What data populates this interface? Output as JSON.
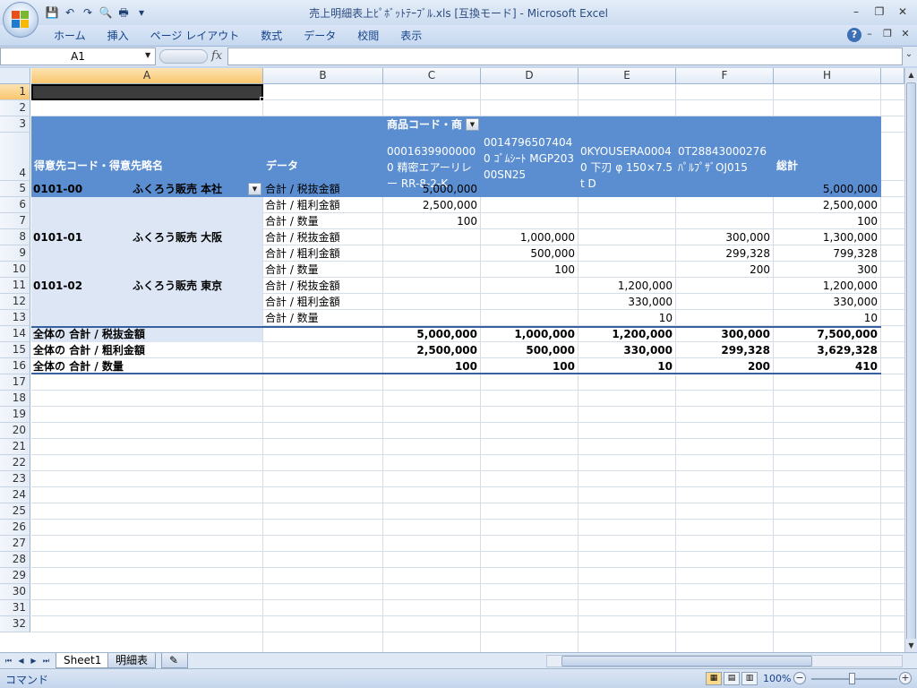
{
  "window": {
    "title": "売上明細表上ﾋﾟﾎﾞｯﾄﾃｰﾌﾞﾙ.xls  [互換モード] - Microsoft Excel",
    "minimize": "–",
    "restore": "❐",
    "close": "✕"
  },
  "qat": {
    "save": "💾",
    "undo": "↶",
    "redo": "↷",
    "preview": "🔍",
    "print": "🖶",
    "more": "▾"
  },
  "ribbon": {
    "tabs": [
      "ホーム",
      "挿入",
      "ページ レイアウト",
      "数式",
      "データ",
      "校閲",
      "表示"
    ],
    "help": "?",
    "ctrl_min": "–",
    "ctrl_restore": "❐",
    "ctrl_close": "✕"
  },
  "formula_bar": {
    "name_box": "A1",
    "fx": "fx",
    "value": ""
  },
  "columns": [
    "A",
    "B",
    "C",
    "D",
    "E",
    "F",
    "H"
  ],
  "rows": [
    "1",
    "2",
    "3",
    "4",
    "5",
    "6",
    "7",
    "8",
    "9",
    "10",
    "11",
    "12",
    "13",
    "14",
    "15",
    "16",
    "17",
    "18",
    "19",
    "20",
    "21",
    "22",
    "23",
    "24",
    "25",
    "26",
    "27",
    "28",
    "29",
    "30",
    "31",
    "32"
  ],
  "pivot": {
    "col_field": "商品コード・商",
    "row_field": "得意先コード・得意先略名",
    "data_field": "データ",
    "products": [
      "00016399000000 精密エアーリレー RR-8-2-K",
      "00147965074040 ｺﾞﾑｼｰﾄ MGP20300SN25",
      "0KYOUSERA00040 下刃 φ 150×7.5t  D",
      "0T28843000276 ﾊﾟﾙﾌﾟｻﾞOJ015"
    ],
    "grand_total_label": "総計",
    "customers": [
      {
        "code": "0101-00",
        "name": "ふくろう販売  本社",
        "rows": [
          {
            "label": "合計 / 税抜金額",
            "c": "5,000,000",
            "d": "",
            "e": "",
            "f": "",
            "h": "5,000,000"
          },
          {
            "label": "合計 / 粗利金額",
            "c": "2,500,000",
            "d": "",
            "e": "",
            "f": "",
            "h": "2,500,000"
          },
          {
            "label": "合計 / 数量",
            "c": "100",
            "d": "",
            "e": "",
            "f": "",
            "h": "100"
          }
        ]
      },
      {
        "code": "0101-01",
        "name": "ふくろう販売  大阪",
        "rows": [
          {
            "label": "合計 / 税抜金額",
            "c": "",
            "d": "1,000,000",
            "e": "",
            "f": "300,000",
            "h": "1,300,000"
          },
          {
            "label": "合計 / 粗利金額",
            "c": "",
            "d": "500,000",
            "e": "",
            "f": "299,328",
            "h": "799,328"
          },
          {
            "label": "合計 / 数量",
            "c": "",
            "d": "100",
            "e": "",
            "f": "200",
            "h": "300"
          }
        ]
      },
      {
        "code": "0101-02",
        "name": "ふくろう販売  東京",
        "rows": [
          {
            "label": "合計 / 税抜金額",
            "c": "",
            "d": "",
            "e": "1,200,000",
            "f": "",
            "h": "1,200,000"
          },
          {
            "label": "合計 / 粗利金額",
            "c": "",
            "d": "",
            "e": "330,000",
            "f": "",
            "h": "330,000"
          },
          {
            "label": "合計 / 数量",
            "c": "",
            "d": "",
            "e": "10",
            "f": "",
            "h": "10"
          }
        ]
      }
    ],
    "totals": [
      {
        "label": "全体の 合計 / 税抜金額",
        "c": "5,000,000",
        "d": "1,000,000",
        "e": "1,200,000",
        "f": "300,000",
        "h": "7,500,000"
      },
      {
        "label": "全体の 合計 / 粗利金額",
        "c": "2,500,000",
        "d": "500,000",
        "e": "330,000",
        "f": "299,328",
        "h": "3,629,328"
      },
      {
        "label": "全体の 合計 / 数量",
        "c": "100",
        "d": "100",
        "e": "10",
        "f": "200",
        "h": "410"
      }
    ]
  },
  "sheet_tabs": [
    "Sheet1",
    "明細表"
  ],
  "sheet_nav": [
    "⏮",
    "◀",
    "▶",
    "⏭"
  ],
  "status": {
    "mode": "コマンド",
    "zoom": "100%",
    "zoom_minus": "−",
    "zoom_plus": "+",
    "view_normal": "▦",
    "view_layout": "▤",
    "view_break": "▥"
  },
  "colors": {
    "pivot_header": "#5b8ed0",
    "pivot_row_label": "#dce6f4",
    "selection": "#3c3c3c"
  }
}
